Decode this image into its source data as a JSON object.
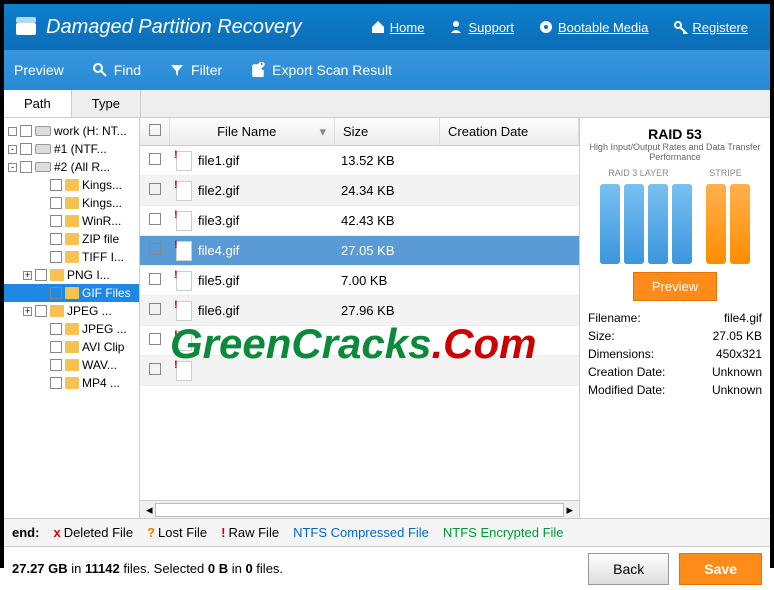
{
  "header": {
    "title": "Damaged Partition Recovery",
    "links": [
      "Home",
      "Support",
      "Bootable Media",
      "Registere"
    ]
  },
  "toolbar": {
    "preview": "Preview",
    "find": "Find",
    "filter": "Filter",
    "export": "Export Scan Result"
  },
  "tabs": {
    "path": "Path",
    "type": "Type"
  },
  "tree": [
    {
      "label": "work (H: NT...",
      "icon": "drv",
      "indent": 0,
      "exp": ""
    },
    {
      "label": "#1 (NTF...",
      "icon": "drv",
      "indent": 0,
      "exp": "-"
    },
    {
      "label": "#2 (All R...",
      "icon": "drv",
      "indent": 0,
      "exp": "-"
    },
    {
      "label": "Kings...",
      "icon": "fldr",
      "indent": 2
    },
    {
      "label": "Kings...",
      "icon": "fldr",
      "indent": 2
    },
    {
      "label": "WinR...",
      "icon": "fldr",
      "indent": 2
    },
    {
      "label": "ZIP file",
      "icon": "fldr",
      "indent": 2
    },
    {
      "label": "TIFF I...",
      "icon": "fldr",
      "indent": 2
    },
    {
      "label": "PNG I...",
      "icon": "fldr",
      "indent": 1,
      "exp": "+"
    },
    {
      "label": "GIF Files",
      "icon": "fldr",
      "indent": 2,
      "sel": true
    },
    {
      "label": "JPEG ...",
      "icon": "fldr",
      "indent": 1,
      "exp": "+"
    },
    {
      "label": "JPEG ...",
      "icon": "fldr",
      "indent": 2
    },
    {
      "label": "AVI Clip",
      "icon": "fldr",
      "indent": 2
    },
    {
      "label": "WAV...",
      "icon": "fldr",
      "indent": 2
    },
    {
      "label": "MP4 ...",
      "icon": "fldr",
      "indent": 2
    }
  ],
  "cols": {
    "name": "File Name",
    "size": "Size",
    "date": "Creation Date"
  },
  "files": [
    {
      "name": "file1.gif",
      "size": "13.52 KB"
    },
    {
      "name": "file2.gif",
      "size": "24.34 KB"
    },
    {
      "name": "file3.gif",
      "size": "42.43 KB"
    },
    {
      "name": "file4.gif",
      "size": "27.05 KB",
      "sel": true
    },
    {
      "name": "file5.gif",
      "size": "7.00 KB"
    },
    {
      "name": "file6.gif",
      "size": "27.96 KB"
    },
    {
      "name": "",
      "size": ""
    },
    {
      "name": "",
      "size": ""
    }
  ],
  "preview": {
    "title": "RAID 53",
    "sub": "High Input/Output Rates and Data Transfer Performance",
    "l1": "RAID 3 LAYER",
    "l2": "STRIPE",
    "btn": "Preview",
    "rows": [
      {
        "k": "Filename:",
        "v": "file4.gif"
      },
      {
        "k": "Size:",
        "v": "27.05 KB"
      },
      {
        "k": "Dimensions:",
        "v": "450x321"
      },
      {
        "k": "Creation Date:",
        "v": "Unknown"
      },
      {
        "k": "Modified Date:",
        "v": "Unknown"
      }
    ]
  },
  "legend": {
    "end": "end:",
    "items": [
      {
        "sym": "x",
        "col": "#d00",
        "label": "Deleted File"
      },
      {
        "sym": "?",
        "col": "#e67e00",
        "label": "Lost File"
      },
      {
        "sym": "!",
        "col": "#d00",
        "label": "Raw File"
      },
      {
        "sym": "",
        "col": "",
        "label": "NTFS Compressed File",
        "txtcol": "#0066cc"
      },
      {
        "sym": "",
        "col": "",
        "label": "NTFS Encrypted File",
        "txtcol": "#009933"
      }
    ]
  },
  "status": {
    "text_pre": "27.27 GB",
    "text_mid1": " in ",
    "text_files": "11142",
    "text_mid2": " files.  Selected ",
    "text_b": "0 B",
    "text_mid3": " in ",
    "text_n": "0",
    "text_end": " files.",
    "back": "Back",
    "save": "Save"
  },
  "watermark": {
    "a": "GreenCracks",
    "b": ".Com"
  }
}
